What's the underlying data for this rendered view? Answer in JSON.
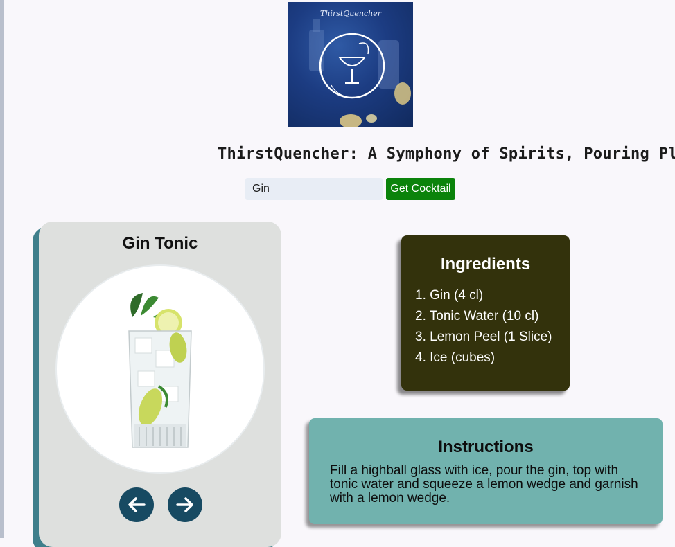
{
  "header": {
    "logo_text": "ThirstQuencher",
    "tagline": "ThirstQuencher: A Symphony of Spirits, Pouring Pleasure"
  },
  "search": {
    "value": "Gin",
    "button_label": "Get Cocktail"
  },
  "cocktail": {
    "name": "Gin Tonic",
    "prev_icon": "arrow-left-icon",
    "next_icon": "arrow-right-icon"
  },
  "ingredients": {
    "title": "Ingredients",
    "items": [
      "1. Gin (4 cl)",
      "2. Tonic Water (10 cl)",
      "3. Lemon Peel (1 Slice)",
      "4. Ice (cubes)"
    ]
  },
  "instructions": {
    "title": "Instructions",
    "text": "Fill a highball glass with ice, pour the gin, top with tonic water and squeeze a lemon wedge and garnish with a lemon wedge."
  },
  "colors": {
    "background": "#f9f7fb",
    "button_green": "#0b830b",
    "ingredients_bg": "#33320c",
    "instructions_bg": "#71b2ae",
    "nav_button": "#174a62"
  }
}
